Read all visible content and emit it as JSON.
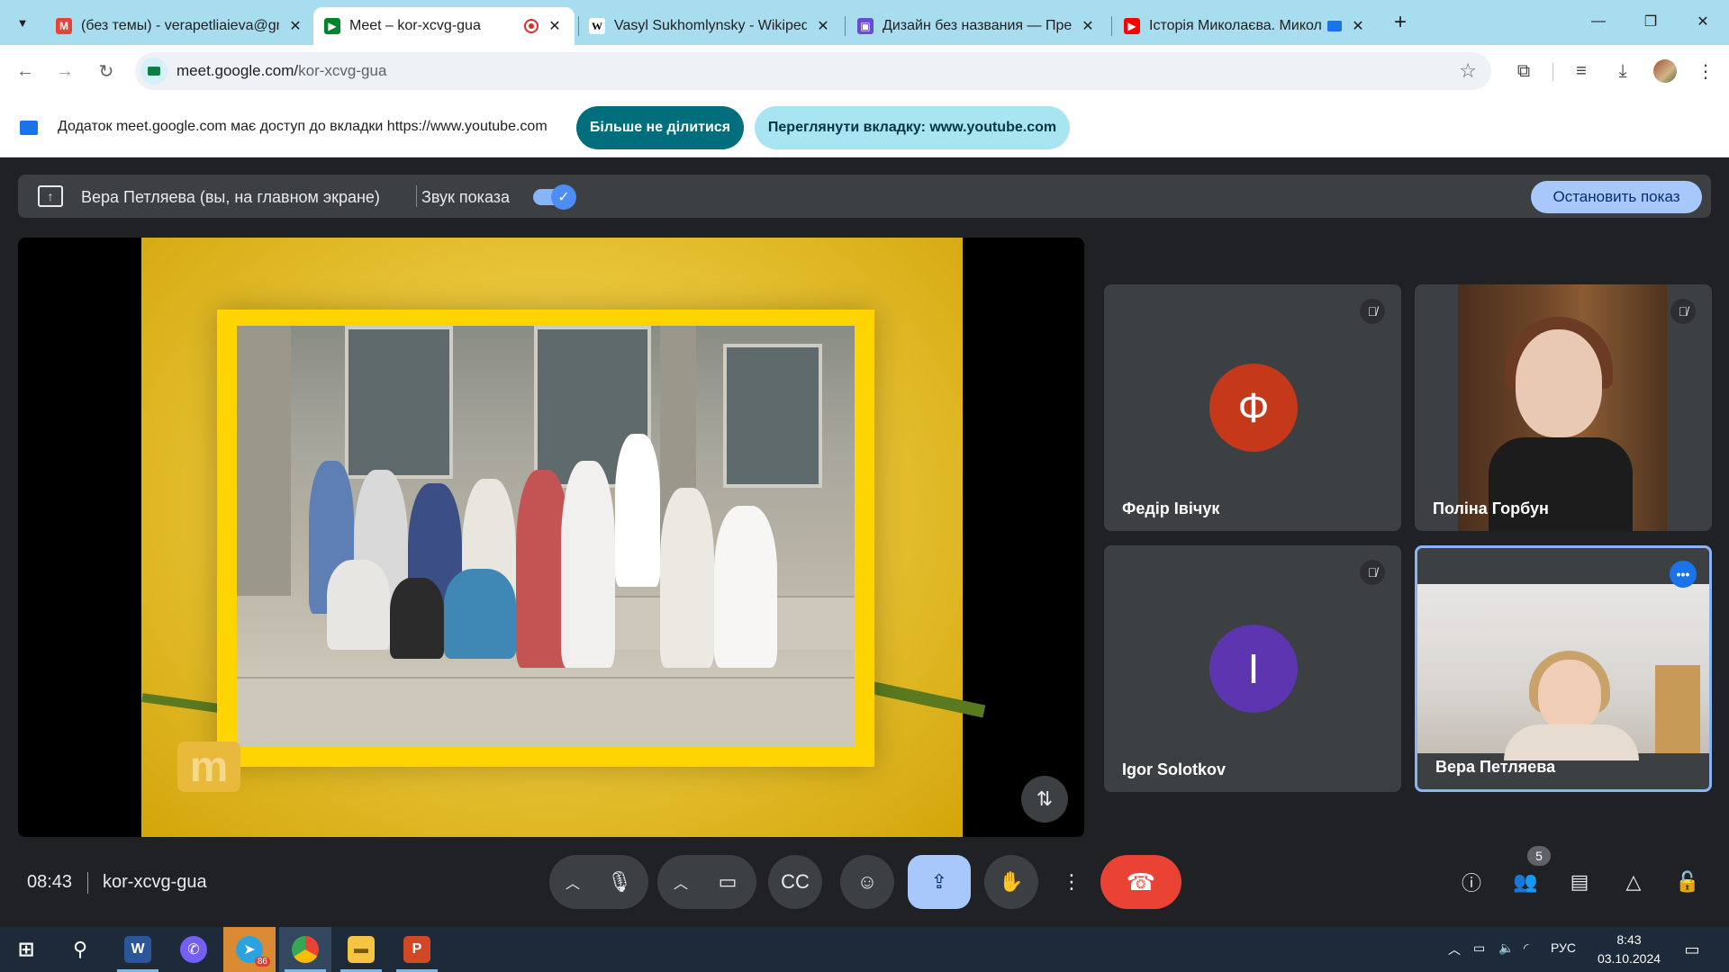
{
  "browser": {
    "tabs": [
      {
        "title": "(без темы) - verapetliaieva@gm",
        "favicon": "gmail-icon",
        "active": false
      },
      {
        "title": "Meet – kor-xcvg-gua",
        "favicon": "meet-icon",
        "active": true
      },
      {
        "title": "Vasyl Sukhomlynsky - Wikipedia",
        "favicon": "wikipedia-icon",
        "active": false
      },
      {
        "title": "Дизайн без названия — През",
        "favicon": "canva-icon",
        "active": false
      },
      {
        "title": "Історія Миколаєва. Микол",
        "favicon": "youtube-icon",
        "active": false
      }
    ],
    "url_host": "meet.google.com/",
    "url_path": "kor-xcvg-gua",
    "new_tab_label": "+"
  },
  "infobar": {
    "message": "Додаток meet.google.com має доступ до вкладки https://www.youtube.com",
    "stop_sharing_label": "Більше не ділитися",
    "view_tab_label": "Переглянути вкладку: www.youtube.com"
  },
  "presenter": {
    "name": "Вера Петляева (вы, на главном экране)",
    "audio_label": "Звук показа",
    "audio_on": true,
    "stop_label": "Остановить показ"
  },
  "participants": [
    {
      "name": "Федір Івічук",
      "initial": "Ф",
      "color": "#c5391a",
      "muted": true,
      "camera": false
    },
    {
      "name": "Поліна Горбун",
      "initial": "",
      "color": "",
      "muted": true,
      "camera": true
    },
    {
      "name": "Igor Solotkov",
      "initial": "I",
      "color": "#5e35b1",
      "muted": true,
      "camera": false
    },
    {
      "name": "Вера Петляева",
      "initial": "",
      "color": "",
      "muted": false,
      "camera": true
    }
  ],
  "meeting": {
    "time": "08:43",
    "code": "kor-xcvg-gua",
    "participant_count": "5"
  },
  "taskbar": {
    "telegram_badge": "86",
    "language": "РУС",
    "clock_time": "8:43",
    "clock_date": "03.10.2024"
  },
  "colors": {
    "accent": "#8ab4f8",
    "leave": "#ea4335",
    "present_active": "#a8c7fa",
    "tab_strip": "#a8dcef",
    "share_button": "#006e7d"
  }
}
